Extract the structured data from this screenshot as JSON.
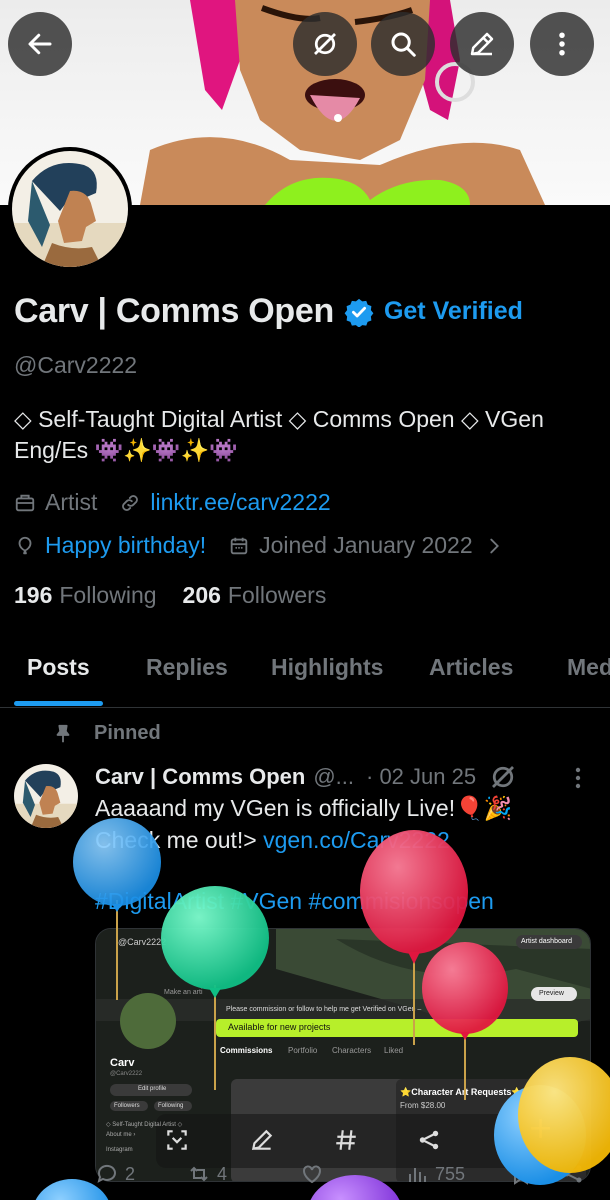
{
  "header": {
    "back_icon": "arrow-left-icon",
    "grok_icon": "grok-slash-icon",
    "search_icon": "search-icon",
    "edit_icon": "pencil-icon",
    "more_icon": "vertical-dots-icon"
  },
  "profile": {
    "display_name": "Carv | Comms Open",
    "get_verified": "Get Verified",
    "handle": "@Carv2222",
    "bio": "◇ Self-Taught Digital Artist ◇ Comms Open ◇ VGen Eng/Es 👾✨👾✨👾",
    "category": "Artist",
    "link": "linktr.ee/carv2222",
    "birthday": "Happy birthday!",
    "joined": "Joined January 2022",
    "following_count": "196",
    "following_label": "Following",
    "followers_count": "206",
    "followers_label": "Followers",
    "colors": {
      "accent": "#1d9bf0",
      "muted": "#71767b",
      "text": "#e7e9ea",
      "background": "#000000"
    }
  },
  "tabs": [
    {
      "label": "Posts",
      "active": true
    },
    {
      "label": "Replies",
      "active": false
    },
    {
      "label": "Highlights",
      "active": false
    },
    {
      "label": "Articles",
      "active": false
    },
    {
      "label": "Med",
      "active": false
    }
  ],
  "post": {
    "pinned_label": "Pinned",
    "author": "Carv | Comms Open",
    "handle": "@...",
    "date": "· 02 Jun 25",
    "text_line1": "Aaaaand my VGen is officially Live!🎈🎉",
    "text_line2_prefix": "Check me out!> ",
    "text_link": "vgen.co/Carv2222",
    "hashtags": "#DigitalArtist #VGen #commisionsopen",
    "media": {
      "top_handle": "@Carv2222",
      "dashboard_button": "Artist dashboard",
      "search_placeholder": "Make an arti",
      "preview_button": "Preview",
      "notice": "Please commission or follow to help me get Verified on VGen –",
      "available": "Available for new projects",
      "tabs": [
        "Commissions",
        "Portfolio",
        "Characters",
        "Liked"
      ],
      "name": "Carv",
      "name_handle": "@Carv2222",
      "edit_profile": "Edit profile",
      "followers": "Followers",
      "following": "Following",
      "bio_line": "◇ Self-Taught Digital Artist ◇",
      "about": "About me ›",
      "instagram": "Instagram",
      "card_title": "⭐Character Art Requests⭐",
      "card_price": "From $28.00"
    },
    "replies": "2",
    "reposts": "4",
    "views": "755"
  }
}
